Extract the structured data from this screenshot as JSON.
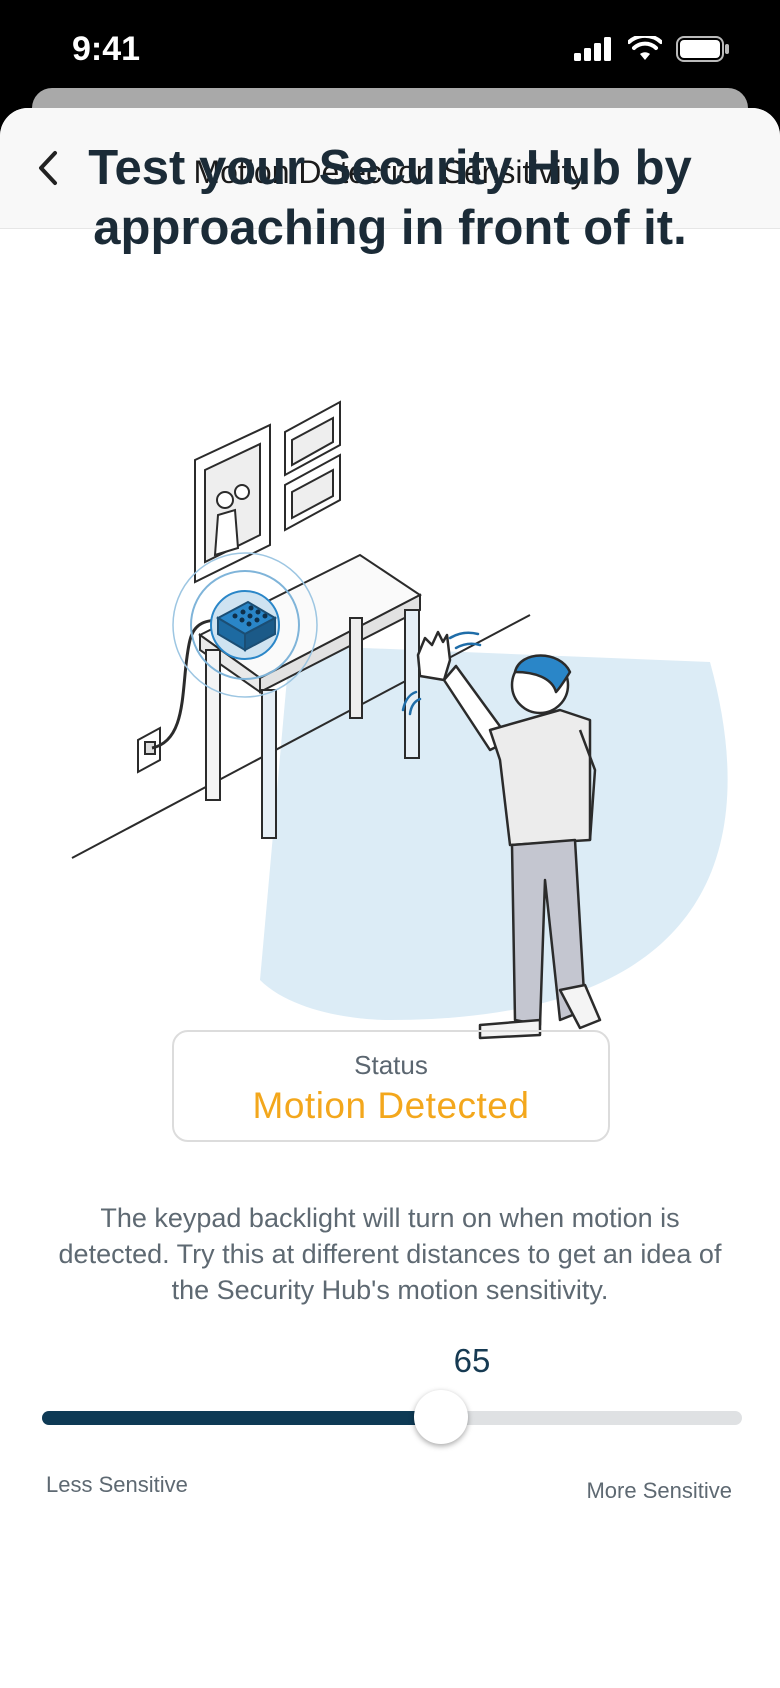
{
  "status_bar": {
    "time": "9:41",
    "icons": [
      "cellular-signal-icon",
      "wifi-icon",
      "battery-icon"
    ]
  },
  "nav": {
    "title": "Motion Detection Sensitivity",
    "back_icon": "chevron-left-icon"
  },
  "headline": "Test your Security Hub by approaching in front of it.",
  "status": {
    "label": "Status",
    "value": "Motion Detected"
  },
  "description": "The keypad backlight will turn on when motion is detected. Try this at different distances to get an idea of the Security Hub's motion sensitivity.",
  "slider": {
    "value": "65",
    "percent": 65,
    "min_label": "Less Sensitive",
    "max_label": "More Sensitive"
  },
  "colors": {
    "accent": "#f3a71c",
    "track_fill": "#0e3a55",
    "headline": "#1b2b37",
    "detection_zone": "#dcecf6",
    "hub_blue": "#2a86c8"
  }
}
